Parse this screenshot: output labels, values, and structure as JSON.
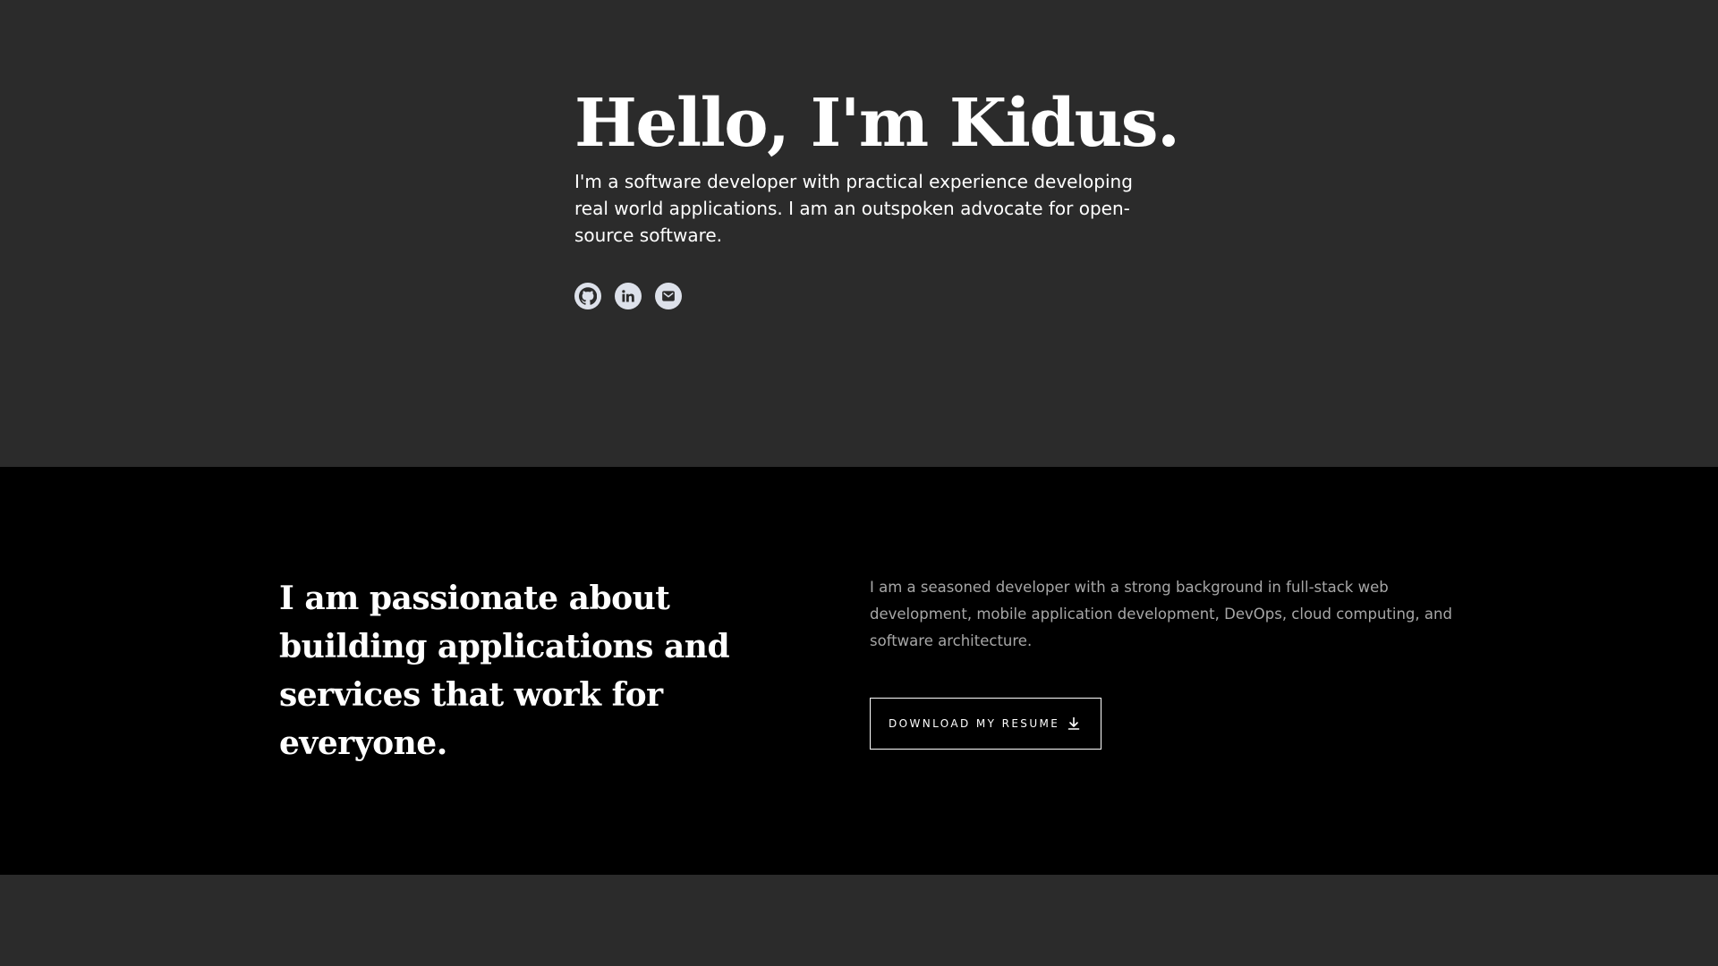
{
  "hero": {
    "title": "Hello, I'm Kidus.",
    "subtitle": "I'm a software developer with practical experience developing real world applications. I am an outspoken advocate for open-source software.",
    "socials": [
      {
        "icon": "github-icon"
      },
      {
        "icon": "linkedin-icon"
      },
      {
        "icon": "email-icon"
      }
    ]
  },
  "about": {
    "heading": "I am passionate about building applications and services that work for everyone.",
    "description": "I am a seasoned developer with a strong background in full-stack web development, mobile application development, DevOps, cloud computing, and software architecture.",
    "resume_button_label": "DOWNLOAD MY RESUME",
    "resume_button_icon": "download-icon"
  },
  "colors": {
    "hero_background": "#2b2b2b",
    "about_background": "#000000",
    "text_primary": "#ffffff",
    "text_muted": "#a7a7a7",
    "icon_circle": "#dde1ea"
  }
}
